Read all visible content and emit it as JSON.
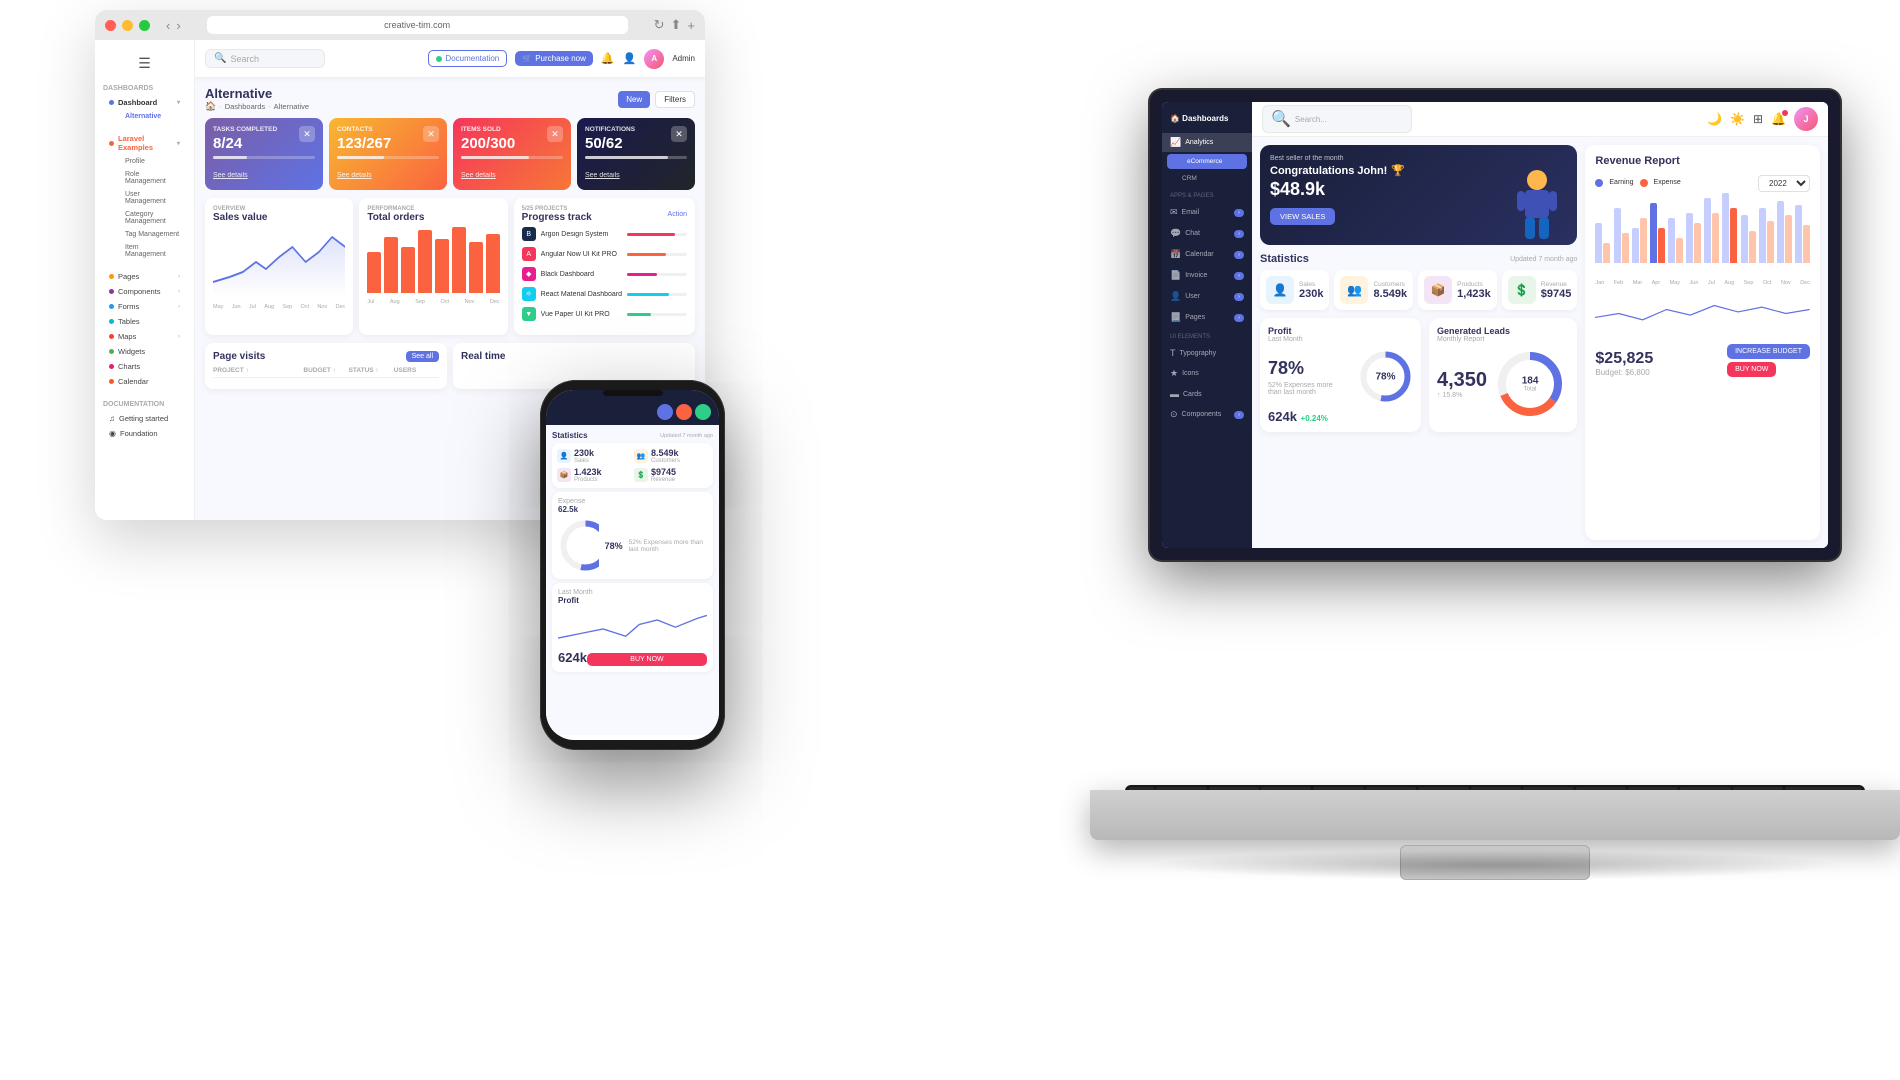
{
  "browser": {
    "url": "creative-tim.com",
    "page_title": "Alternative",
    "breadcrumb": {
      "home": "🏠",
      "dashboards": "Dashboards",
      "current": "Alternative"
    },
    "buttons": {
      "new": "New",
      "filters": "Filters"
    }
  },
  "topnav": {
    "search_placeholder": "Search",
    "doc_btn": "Documentation",
    "purchase_btn": "Purchase now",
    "admin_label": "Admin"
  },
  "sidebar": {
    "menu_sections": [
      {
        "title": "DASHBOARDS",
        "items": [
          {
            "label": "Dashboard",
            "type": "parent"
          },
          {
            "label": "Alternative",
            "type": "child",
            "active": true
          }
        ]
      },
      {
        "title": "LARAVEL EXAMPLES",
        "items": [
          {
            "label": "Profile"
          },
          {
            "label": "Role Management"
          },
          {
            "label": "User Management"
          },
          {
            "label": "Category Management"
          },
          {
            "label": "Tag Management"
          },
          {
            "label": "Item Management"
          }
        ]
      },
      {
        "title": "",
        "items": [
          {
            "label": "Pages"
          },
          {
            "label": "Components"
          },
          {
            "label": "Forms"
          },
          {
            "label": "Tables"
          },
          {
            "label": "Maps"
          },
          {
            "label": "Widgets"
          },
          {
            "label": "Charts"
          },
          {
            "label": "Calendar"
          }
        ]
      },
      {
        "title": "DOCUMENTATION",
        "items": [
          {
            "label": "Getting started"
          },
          {
            "label": "Foundation"
          }
        ]
      }
    ]
  },
  "stats_cards": [
    {
      "label": "TASKS COMPLETED",
      "value": "8/24",
      "progress": 33,
      "link": "See details",
      "theme": "blue"
    },
    {
      "label": "CONTACTS",
      "value": "123/267",
      "progress": 46,
      "link": "See details",
      "theme": "orange"
    },
    {
      "label": "ITEMS SOLD",
      "value": "200/300",
      "progress": 67,
      "link": "See details",
      "theme": "red"
    },
    {
      "label": "NOTIFICATIONS",
      "value": "50/62",
      "progress": 81,
      "link": "See details",
      "theme": "dark"
    }
  ],
  "sales_chart": {
    "label": "OVERVIEW",
    "title": "Sales value",
    "x_labels": [
      "May",
      "Jun",
      "Jul",
      "Aug",
      "Sep",
      "Oct",
      "Nov",
      "Dec"
    ]
  },
  "orders_chart": {
    "label": "PERFORMANCE",
    "title": "Total orders",
    "x_labels": [
      "Jul",
      "Aug",
      "Sep",
      "Oct",
      "Nov",
      "Dec"
    ],
    "bars": [
      20,
      28,
      22,
      30,
      27,
      32,
      25,
      29
    ]
  },
  "progress_track": {
    "label": "5/25 PROJECTS",
    "title": "Progress track",
    "action": "Action",
    "items": [
      {
        "name": "Argon Design System",
        "color": "red",
        "progress": 80,
        "icon": "B",
        "icon_bg": "#172b4d"
      },
      {
        "name": "Angular Now UI Kit PRO",
        "color": "orange",
        "progress": 65,
        "icon": "A",
        "icon_bg": "#f5365c"
      },
      {
        "name": "Black Dashboard",
        "color": "pink",
        "progress": 50,
        "icon": "◆",
        "icon_bg": "#e91e8c"
      },
      {
        "name": "React Material Dashboard",
        "color": "blue",
        "progress": 70,
        "icon": "⚛",
        "icon_bg": "#11cdef"
      },
      {
        "name": "Vue Paper UI Kit PRO",
        "color": "green",
        "progress": 40,
        "icon": "▼",
        "icon_bg": "#2dce89"
      }
    ]
  },
  "page_visits": {
    "title": "Page visits",
    "see_all": "See all",
    "columns": [
      "PROJECT ↑",
      "BUDGET ↑",
      "STATUS ↑",
      "USERS"
    ]
  },
  "real_time": {
    "title": "Real time"
  },
  "laptop": {
    "sidebar_items": [
      {
        "label": "Dashboards",
        "icon": "⊞"
      },
      {
        "label": "Analytics",
        "icon": "📈"
      },
      {
        "label": "eCommerce",
        "icon": "🛒",
        "active": true
      },
      {
        "label": "CRM",
        "icon": "👥"
      }
    ],
    "sidebar_sub": [
      {
        "label": "Email",
        "icon": "✉"
      },
      {
        "label": "Chat",
        "icon": "💬"
      },
      {
        "label": "Calendar",
        "icon": "📅"
      },
      {
        "label": "Invoice",
        "icon": "📄"
      },
      {
        "label": "User",
        "icon": "👤"
      },
      {
        "label": "Pages",
        "icon": "📃"
      },
      {
        "label": "Typography",
        "icon": "T"
      },
      {
        "label": "Icons",
        "icon": "★"
      },
      {
        "label": "Cards",
        "icon": "▬"
      },
      {
        "label": "Components",
        "icon": "⊙"
      }
    ],
    "congrats": {
      "subtitle": "Best seller of the month",
      "title": "Congratulations John!",
      "price": "$48.9k",
      "btn": "VIEW SALES"
    },
    "stats": [
      {
        "label": "Sales",
        "value": "230k",
        "icon": "👤",
        "icon_class": "lstat-icon-blue"
      },
      {
        "label": "Customers",
        "value": "8.549k",
        "icon": "👥",
        "icon_class": "lstat-icon-orange"
      },
      {
        "label": "Products",
        "value": "1,423k",
        "icon": "📦",
        "icon_class": "lstat-icon-purple"
      },
      {
        "label": "Revenue",
        "value": "$9745",
        "icon": "💲",
        "icon_class": "lstat-icon-green"
      }
    ],
    "section_title": "Statistics",
    "updated": "Updated 7 month ago",
    "profit": {
      "title": "Profit",
      "sub": "Last Month",
      "percent": "78%",
      "value": "624k",
      "change": "+0.24%",
      "footer": "52% Expenses more than last month"
    },
    "leads": {
      "title": "Generated Leads",
      "sub": "Monthly Report",
      "count": "4,350",
      "total": "184",
      "label": "Total",
      "change": "↑ 15.8%"
    },
    "revenue": {
      "title": "Revenue Report",
      "legend_earning": "Earning",
      "legend_expense": "Expense",
      "year": "2022",
      "total": "$25,825",
      "budget": "Budget: $6,800",
      "increase_btn": "INCREASE BUDGET",
      "buy_btn": "BUY NOW",
      "x_labels": [
        "Jan",
        "Feb",
        "Mar",
        "Apr",
        "May",
        "Jun",
        "Jul",
        "Aug",
        "Sep",
        "Oct",
        "Nov",
        "Dec"
      ]
    }
  },
  "phone": {
    "section_title": "Statistics",
    "updated": "Updated 7 month ago",
    "stats": [
      {
        "label": "Sales",
        "value": "230k"
      },
      {
        "label": "Customers",
        "value": "8.549k"
      },
      {
        "label": "Products",
        "value": "1.423k"
      },
      {
        "label": "Revenue",
        "value": "$9745"
      }
    ],
    "expense": {
      "label": "Expense",
      "value": "62.5k"
    },
    "profit": {
      "title": "Profit",
      "sub": "Last Month",
      "value": "624k",
      "buy_btn": "BUY NOW"
    }
  },
  "icons": {
    "search": "🔍",
    "bell": "🔔",
    "user_circle": "👤",
    "docs": "📄",
    "cart": "🛒",
    "home": "🏠",
    "chevron_right": "›",
    "chevron_down": "▾",
    "close": "✕",
    "menu": "☰"
  }
}
